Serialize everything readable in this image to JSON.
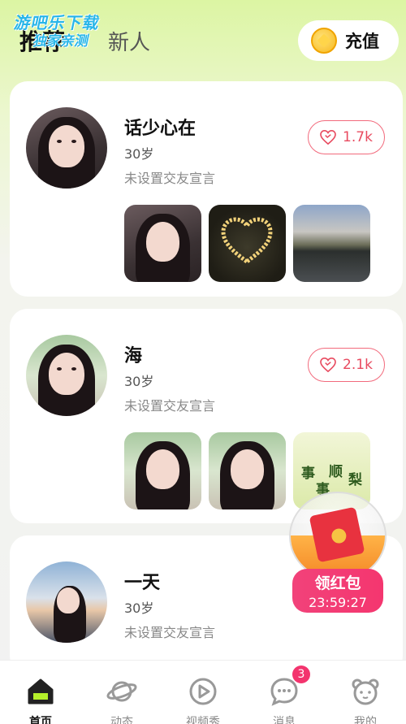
{
  "watermark": {
    "line1": "游吧乐下载",
    "line2": "独家亲测"
  },
  "header": {
    "tabs": [
      {
        "label": "推荐",
        "active": true
      },
      {
        "label": "新人",
        "active": false
      }
    ],
    "recharge_label": "充值"
  },
  "users": [
    {
      "name": "话少心在",
      "age": "30岁",
      "motto": "未设置交友宣言",
      "likes": "1.7k"
    },
    {
      "name": "海",
      "age": "30岁",
      "motto": "未设置交友宣言",
      "likes": "2.1k"
    },
    {
      "name": "一天",
      "age": "30岁",
      "motto": "未设置交友宣言",
      "likes": ""
    }
  ],
  "fruit_photo_text": [
    "事",
    "事",
    "顺",
    "梨"
  ],
  "red_packet": {
    "label": "领红包",
    "timer": "23:59:27"
  },
  "tabbar": {
    "items": [
      {
        "label": "首页",
        "icon": "home-icon",
        "active": true
      },
      {
        "label": "动态",
        "icon": "planet-icon",
        "active": false
      },
      {
        "label": "视频秀",
        "icon": "video-icon",
        "active": false
      },
      {
        "label": "消息",
        "icon": "message-icon",
        "active": false,
        "badge": "3"
      },
      {
        "label": "我的",
        "icon": "bear-icon",
        "active": false
      }
    ]
  },
  "colors": {
    "accent": "#e84b60",
    "badge": "#f3346e",
    "header_bg": "#dcf5a3"
  }
}
